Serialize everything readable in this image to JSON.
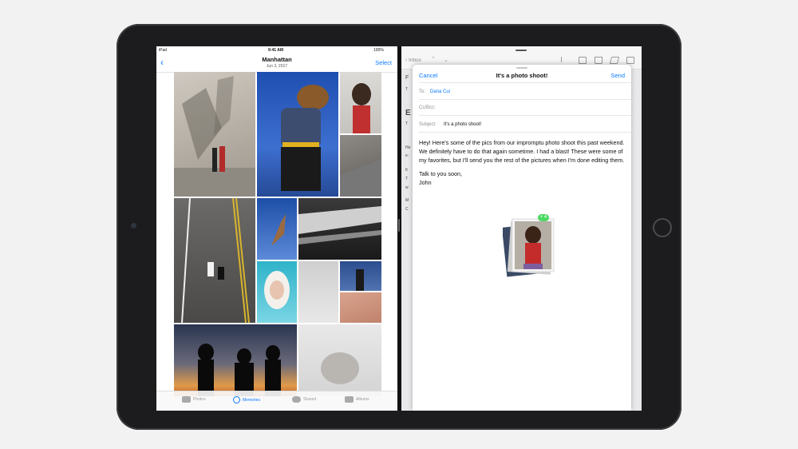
{
  "status": {
    "carrier": "iPad",
    "time": "9:41 AM",
    "battery": "100%"
  },
  "photos": {
    "back_glyph": "‹",
    "title": "Manhattan",
    "date": "Jun 3, 2017",
    "select_label": "Select",
    "tabs": [
      {
        "label": "Photos",
        "icon": "photos-icon"
      },
      {
        "label": "Memories",
        "icon": "memories-icon"
      },
      {
        "label": "Shared",
        "icon": "cloud-icon"
      },
      {
        "label": "Albums",
        "icon": "albums-icon"
      }
    ],
    "active_tab": "Memories"
  },
  "mail": {
    "inbox_label": "Inbox",
    "bg_lines": [
      "F",
      "T",
      "E",
      "T",
      "He",
      "e:",
      "It",
      "T",
      "w",
      "M",
      "C"
    ],
    "compose": {
      "cancel_label": "Cancel",
      "title": "It's a photo shoot!",
      "send_label": "Send",
      "to_label": "To:",
      "to_value": "Dana Cui",
      "ccbcc_label": "Cc/Bcc:",
      "subject_label": "Subject:",
      "subject_value": "It's a photo shoot!",
      "body_p1": "Hey! Here's some of the pics from our impromptu photo shoot this past weekend. We definitely have to do that again sometime. I had a blast! These were some of my favorites, but I'll send you the rest of the pictures when I'm done editing them.",
      "body_p2": "Talk to you soon,",
      "body_p3": "John",
      "drag_badge": "+ 4"
    }
  },
  "colors": {
    "accent": "#0a7aff",
    "badge": "#4cd964",
    "bezel": "#1c1c1e"
  }
}
